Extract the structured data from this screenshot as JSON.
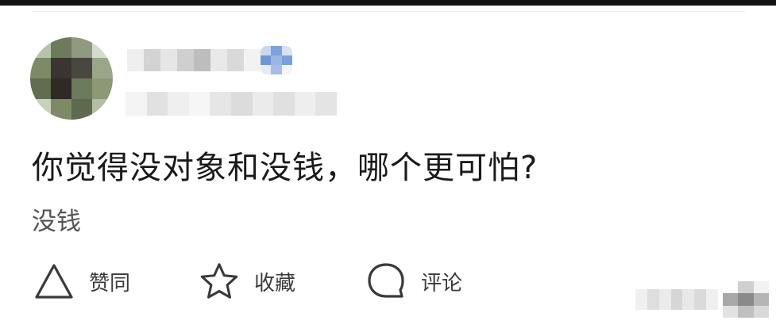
{
  "post": {
    "question": "你觉得没对象和没钱，哪个更可怕?",
    "answer": "没钱"
  },
  "actions": {
    "like_label": "赞同",
    "favorite_label": "收藏",
    "comment_label": "评论"
  },
  "colors": {
    "top_bar": "#121212",
    "text_primary": "#1a1a1a",
    "text_secondary": "#555555",
    "icon_stroke": "#3a3a3a"
  },
  "icons": {
    "like": "triangle-upvote-icon",
    "favorite": "star-outline-icon",
    "comment": "speech-bubble-icon"
  }
}
